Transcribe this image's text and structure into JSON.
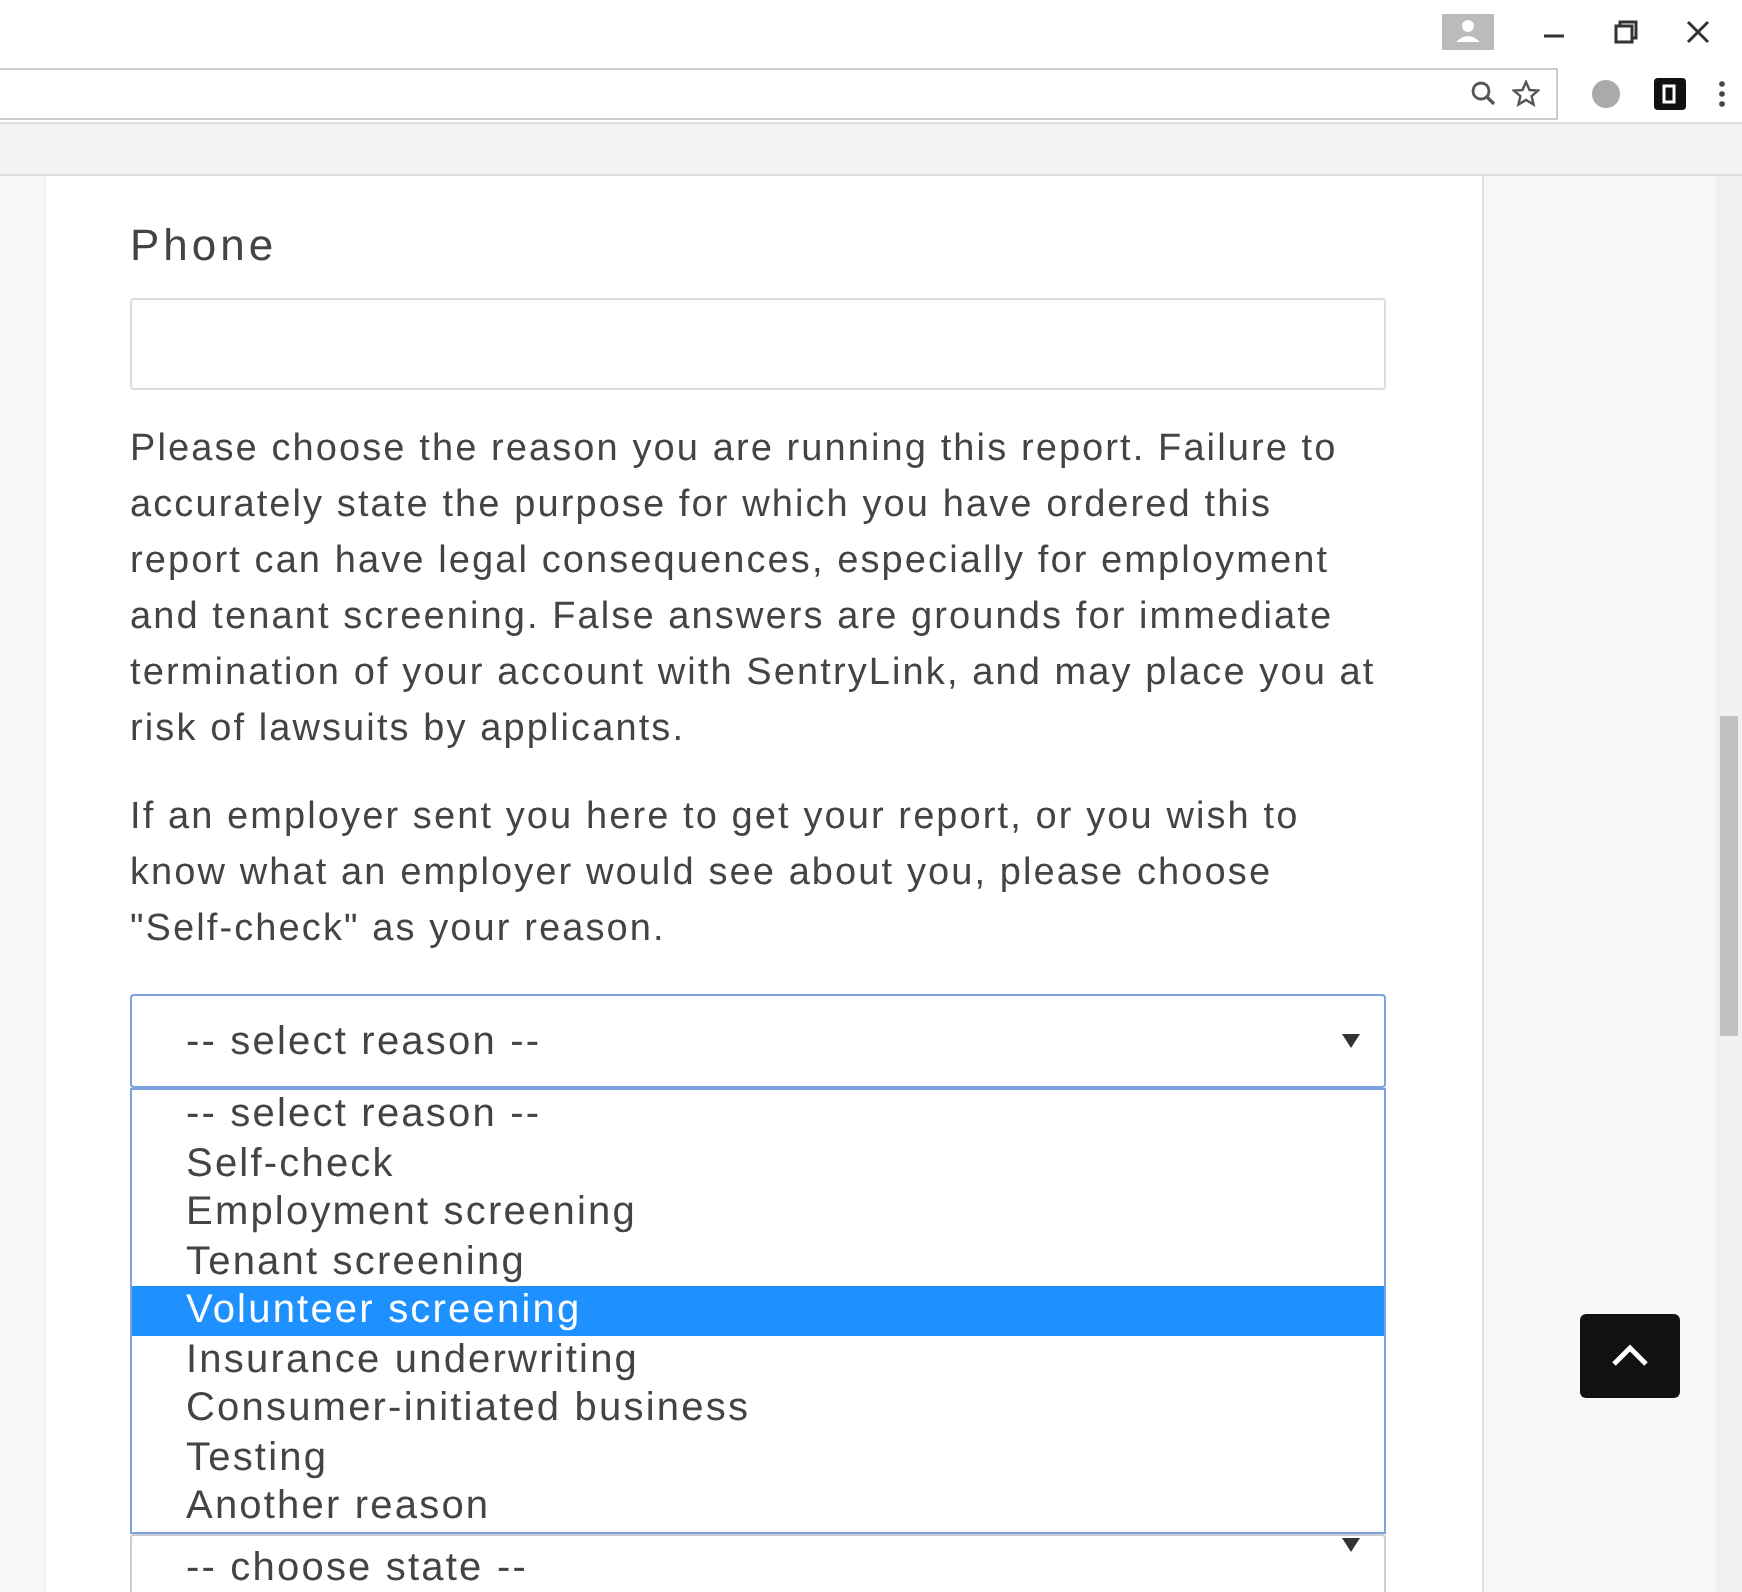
{
  "form": {
    "phone_label": "Phone",
    "paragraphs": [
      "Please choose the reason you are running this report. Failure to accurately state the purpose for which you have ordered this report can have legal consequences, especially for employment and tenant screening. False answers are grounds for immediate termination of your account with SentryLink, and may place you at risk of lawsuits by applicants.",
      "If an employer sent you here to get your report, or you wish to know what an employer would see about you, please choose \"Self-check\" as your reason."
    ],
    "reason_select": {
      "value": "-- select reason --",
      "expanded": true,
      "options": [
        {
          "label": "-- select reason --",
          "highlighted": false
        },
        {
          "label": "Self-check",
          "highlighted": false
        },
        {
          "label": "Employment screening",
          "highlighted": false
        },
        {
          "label": "Tenant screening",
          "highlighted": false
        },
        {
          "label": "Volunteer screening",
          "highlighted": true
        },
        {
          "label": "Insurance underwriting",
          "highlighted": false
        },
        {
          "label": "Consumer-initiated business",
          "highlighted": false
        },
        {
          "label": "Testing",
          "highlighted": false
        },
        {
          "label": "Another reason",
          "highlighted": false
        }
      ]
    },
    "state_select": {
      "value": "-- choose state --"
    }
  }
}
